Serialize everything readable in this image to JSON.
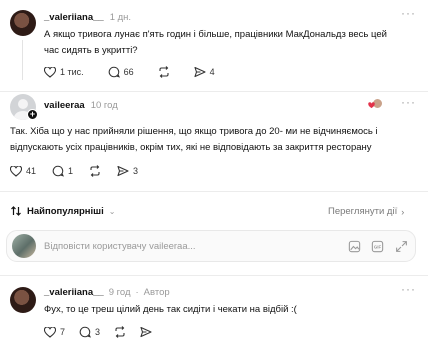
{
  "comment1": {
    "username": "_valeriiana__",
    "time": "1 дн.",
    "text_line1": "А якщо тривога лунає п'ять годин і більше, працівники МакДональдз весь цей",
    "text_line2": "час сидять в укритті?",
    "likes": "1 тис.",
    "replies": "66",
    "shares": "4"
  },
  "comment2": {
    "username": "vaileeraa",
    "time": "10 год",
    "text_line1": "Так. Хіба що у нас прийняли рішення, що якщо тривога до 20- ми не відчиняємось і",
    "text_line2": "відпускають усіх працівників, окрім тих, які не відповідають за закриття ресторану",
    "likes": "41",
    "replies": "1",
    "shares": "3"
  },
  "sort": {
    "label": "Найпопулярніші",
    "view_activity": "Переглянути дії"
  },
  "reply_input": {
    "placeholder": "Відповісти користувачу vaileeraa..."
  },
  "comment3": {
    "username": "_valeriiana__",
    "time": "9 год",
    "author_badge": "Автор",
    "text": "Фух, то це треш цілий день так сидіти і чекати на відбій :(",
    "likes": "7",
    "replies": "3"
  }
}
